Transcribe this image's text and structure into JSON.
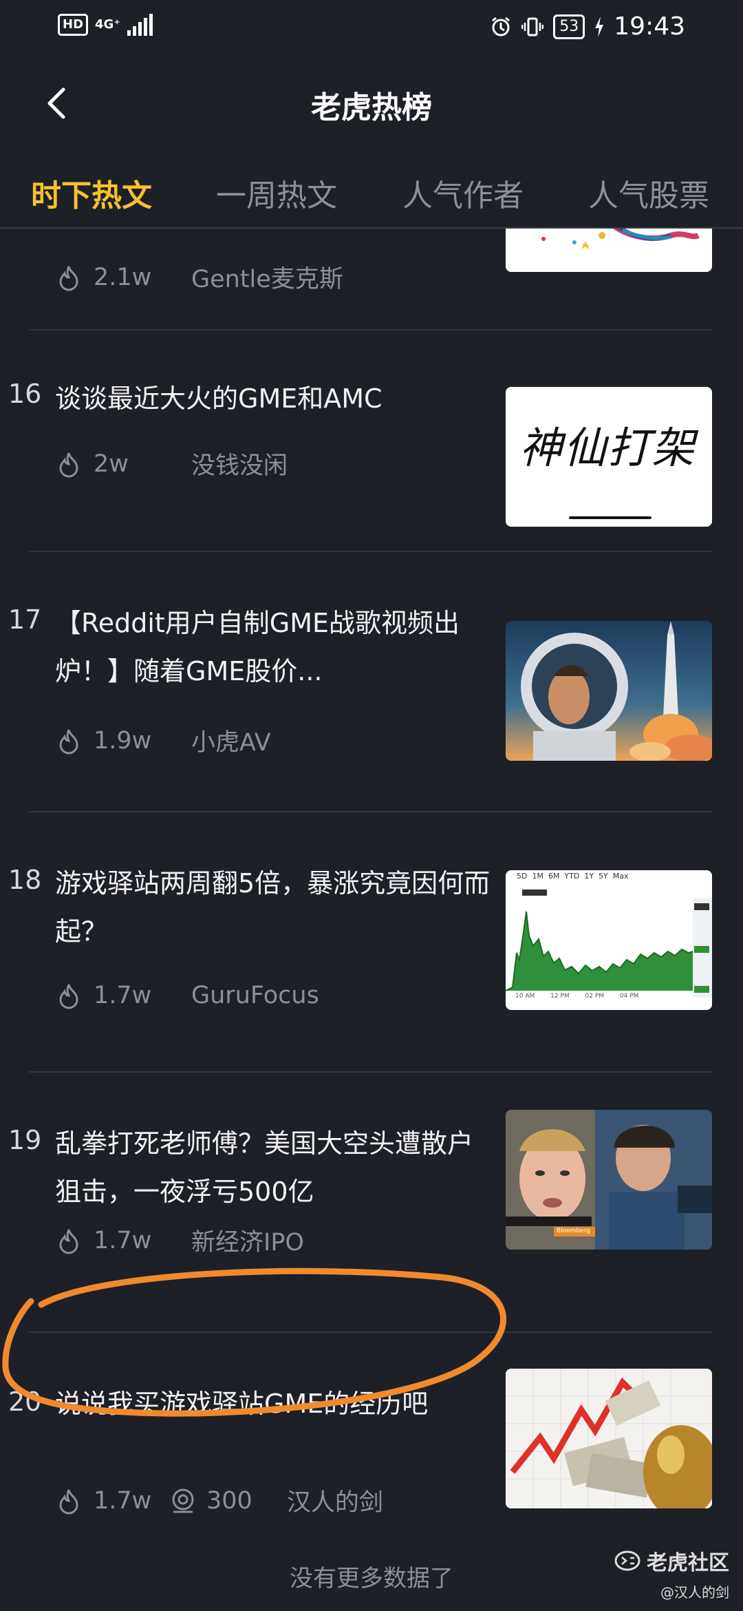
{
  "status_bar": {
    "hd": "HD",
    "network": "4G⁺",
    "battery": "53",
    "time": "19:43"
  },
  "header": {
    "title": "老虎热榜"
  },
  "tabs": [
    {
      "label": "时下热文",
      "active": true
    },
    {
      "label": "一周热文",
      "active": false
    },
    {
      "label": "人气作者",
      "active": false
    },
    {
      "label": "人气股票",
      "active": false
    }
  ],
  "items": [
    {
      "rank": "",
      "title": "",
      "heat": "2.1w",
      "comments": "",
      "author": "Gentle麦克斯",
      "thumb": "cartoon-illustration"
    },
    {
      "rank": "16",
      "title": "谈谈最近大火的GME和AMC",
      "heat": "2w",
      "comments": "",
      "author": "没钱没闲",
      "thumb": "handwriting"
    },
    {
      "rank": "17",
      "title": "【Reddit用户自制GME战歌视频出炉！】随着GME股价...",
      "heat": "1.9w",
      "comments": "",
      "author": "小虎AV",
      "thumb": "astronaut-rocket"
    },
    {
      "rank": "18",
      "title": "游戏驿站两周翻5倍，暴涨究竟因何而起？",
      "heat": "1.7w",
      "comments": "",
      "author": "GuruFocus",
      "thumb": "stock-chart"
    },
    {
      "rank": "19",
      "title": "乱拳打死老师傅？美国大空头遭散户狙击，一夜浮亏500亿",
      "heat": "1.7w",
      "comments": "",
      "author": "新经济IPO",
      "thumb": "two-people"
    },
    {
      "rank": "20",
      "title": "说说我买游戏驿站GME的经历吧",
      "heat": "1.7w",
      "comments": "300",
      "author": "汉人的剑",
      "thumb": "money-egg"
    }
  ],
  "thumb_text": {
    "handwriting": "神仙打架",
    "chart_tabs": "5D  1M  6M  YTD  1Y  5Y  Max",
    "chart_x": "10 AM        12 PM        02 PM        04 PM",
    "bloomberg": "Bloomberg"
  },
  "footer": {
    "no_more": "没有更多数据了"
  },
  "watermark": {
    "brand": "老虎社区",
    "user": "@汉人的剑"
  },
  "colors": {
    "background": "#1e2028",
    "tab_active": "#f5c12e",
    "highlight_circle": "#f08a2c"
  }
}
